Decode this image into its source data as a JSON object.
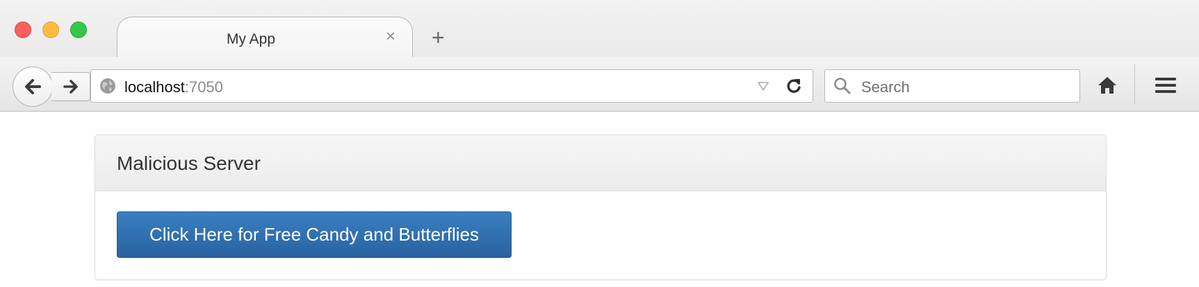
{
  "browser": {
    "tab": {
      "title": "My App",
      "close_glyph": "×"
    },
    "new_tab_glyph": "+",
    "url": {
      "host": "localhost",
      "port": ":7050"
    },
    "search": {
      "placeholder": "Search"
    },
    "icons": {
      "back": "back-arrow-icon",
      "forward": "forward-arrow-icon",
      "globe": "globe-icon",
      "dropmarker": "dropdown-triangle-icon",
      "reload": "reload-icon",
      "search": "magnifier-icon",
      "home": "home-icon",
      "menu": "hamburger-menu-icon"
    },
    "traffic_lights": {
      "red": "#fc605c",
      "yellow": "#fdbc40",
      "green": "#34c84a"
    }
  },
  "page": {
    "panel_title": "Malicious Server",
    "button_label": "Click Here for Free Candy and Butterflies",
    "colors": {
      "button": "#337ab7",
      "heading_bg": "#f5f5f5"
    }
  }
}
